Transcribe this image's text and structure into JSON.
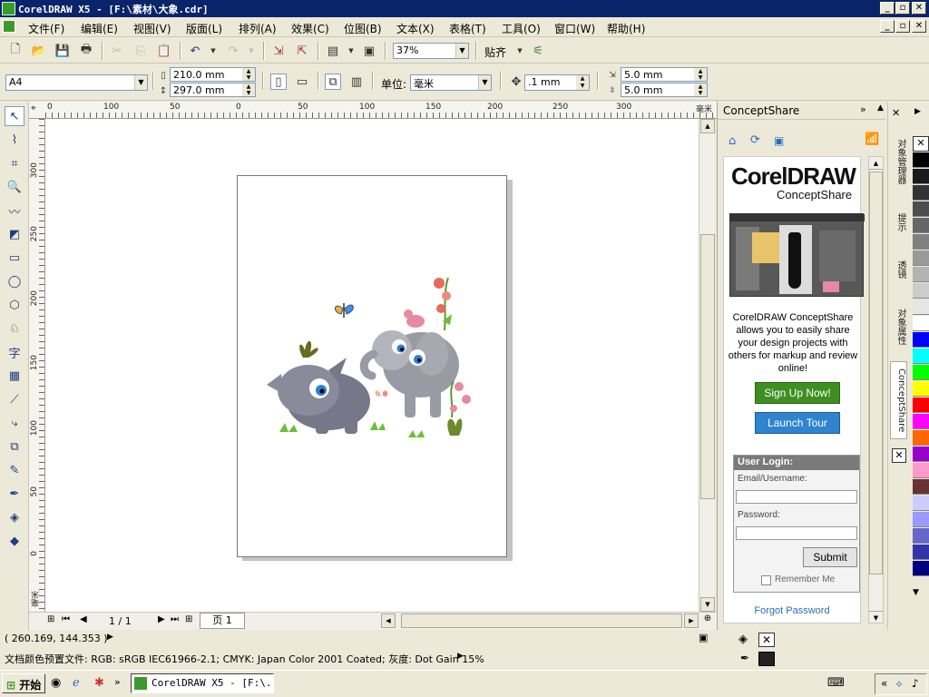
{
  "window": {
    "title": "CorelDRAW X5 - [F:\\素材\\大象.cdr]",
    "min_glyph": "_",
    "max_glyph": "▫",
    "close_glyph": "✕"
  },
  "menu": [
    {
      "label": "文件(F)"
    },
    {
      "label": "编辑(E)"
    },
    {
      "label": "视图(V)"
    },
    {
      "label": "版面(L)"
    },
    {
      "label": "排列(A)"
    },
    {
      "label": "效果(C)"
    },
    {
      "label": "位图(B)"
    },
    {
      "label": "文本(X)"
    },
    {
      "label": "表格(T)"
    },
    {
      "label": "工具(O)"
    },
    {
      "label": "窗口(W)"
    },
    {
      "label": "帮助(H)"
    }
  ],
  "standard_toolbar": {
    "zoom_value": "37%",
    "snap_label": "贴齐"
  },
  "property_bar": {
    "page_size": "A4",
    "width": "210.0 mm",
    "height": "297.0 mm",
    "unit_label": "单位:",
    "unit_value": "毫米",
    "nudge": ".1 mm",
    "dup_x": "5.0 mm",
    "dup_y": "5.0 mm"
  },
  "ruler": {
    "h_ticks": [
      "0",
      "100",
      "50",
      "0",
      "50",
      "100",
      "150",
      "200",
      "250",
      "300",
      "毫米"
    ],
    "v_ticks": [
      "300",
      "250",
      "200",
      "150",
      "100",
      "50",
      "0",
      "毫米"
    ]
  },
  "page_nav": {
    "position": "1 / 1",
    "tab_label": "页 1"
  },
  "docker": {
    "title": "ConceptShare",
    "logo_line1": "CorelDRAW",
    "logo_line2": "ConceptShare",
    "description": "CorelDRAW ConceptShare allows you to easily share your design projects with others for markup and review online!",
    "signup_label": "Sign Up Now!",
    "tour_label": "Launch Tour",
    "login_title": "User Login:",
    "email_label": "Email/Username:",
    "password_label": "Password:",
    "submit_label": "Submit",
    "remember_label": "Remember Me",
    "forgot_label": "Forgot Password"
  },
  "side_tabs": [
    {
      "label": "对象管理器"
    },
    {
      "label": "提示"
    },
    {
      "label": "透镜"
    },
    {
      "label": "对象属性"
    },
    {
      "label": "ConceptShare"
    }
  ],
  "palette": [
    "#000000",
    "#1a1a1a",
    "#333333",
    "#4d4d4d",
    "#666666",
    "#808080",
    "#999999",
    "#b3b3b3",
    "#cccccc",
    "#e6e6e6",
    "#ffffff",
    "#0000ff",
    "#00ffff",
    "#00ff00",
    "#ffff00",
    "#ff0000",
    "#ff00ff",
    "#ff6600",
    "#9900cc",
    "#ff99cc",
    "#663333",
    "#ccccff",
    "#9999ff",
    "#6666cc",
    "#3333aa",
    "#000080"
  ],
  "status": {
    "coords": "( 260.169, 144.353 )",
    "color_profile": "文档颜色预置文件: RGB: sRGB IEC61966-2.1; CMYK: Japan Color 2001 Coated; 灰度: Dot Gain 15%"
  },
  "taskbar": {
    "start_label": "开始",
    "task_label": "CorelDRAW X5 - [F:\\...",
    "chevron": "«"
  }
}
